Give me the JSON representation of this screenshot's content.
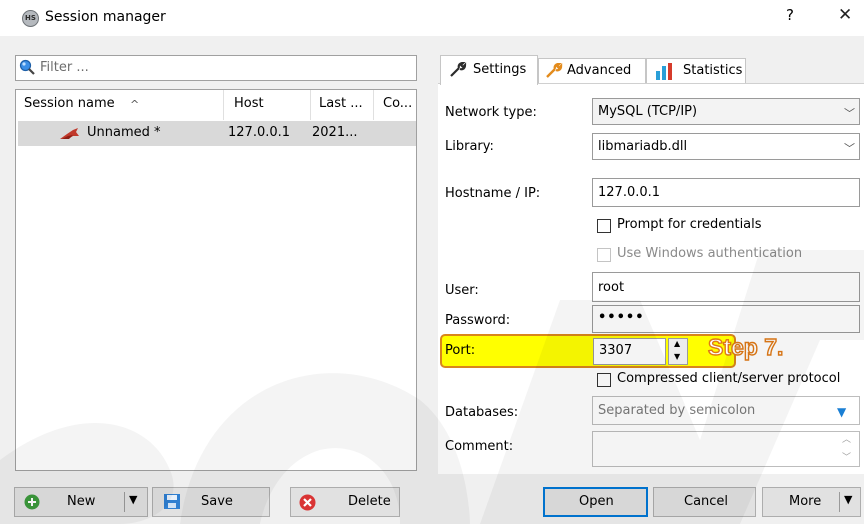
{
  "window": {
    "title": "Session manager",
    "app_icon_text": "HS",
    "help": "?",
    "close": "✕"
  },
  "filter": {
    "placeholder": "Filter ..."
  },
  "sessions": {
    "columns": [
      "Session name",
      "Host",
      "Last ...",
      "Co..."
    ],
    "sort_indicator": "^",
    "rows": [
      {
        "name": "Unnamed *",
        "host": "127.0.0.1",
        "last": "2021..."
      }
    ]
  },
  "tabs": [
    {
      "label": "Settings",
      "icon": "wrench-icon"
    },
    {
      "label": "Advanced",
      "icon": "wrench-orange-icon"
    },
    {
      "label": "Statistics",
      "icon": "bar-chart-icon"
    }
  ],
  "settings": {
    "network_type_label": "Network type:",
    "network_type_value": "MySQL (TCP/IP)",
    "library_label": "Library:",
    "library_value": "libmariadb.dll",
    "hostname_label": "Hostname / IP:",
    "hostname_value": "127.0.0.1",
    "prompt_credentials": "Prompt for credentials",
    "windows_auth": "Use Windows authentication",
    "user_label": "User:",
    "user_value": "root",
    "password_label": "Password:",
    "password_value": "•••••",
    "port_label": "Port:",
    "port_value": "3307",
    "compressed": "Compressed client/server protocol",
    "databases_label": "Databases:",
    "databases_placeholder": "Separated by semicolon",
    "comment_label": "Comment:"
  },
  "annotation": {
    "step": "Step 7."
  },
  "buttons": {
    "new": "New",
    "save": "Save",
    "delete": "Delete",
    "open": "Open",
    "cancel": "Cancel",
    "more": "More"
  },
  "colors": {
    "highlight": "#ffff00",
    "highlight_border": "#d9861c",
    "step_text": "#ffffff",
    "step_outline": "#e07a16",
    "selection": "#d9d9d9"
  }
}
